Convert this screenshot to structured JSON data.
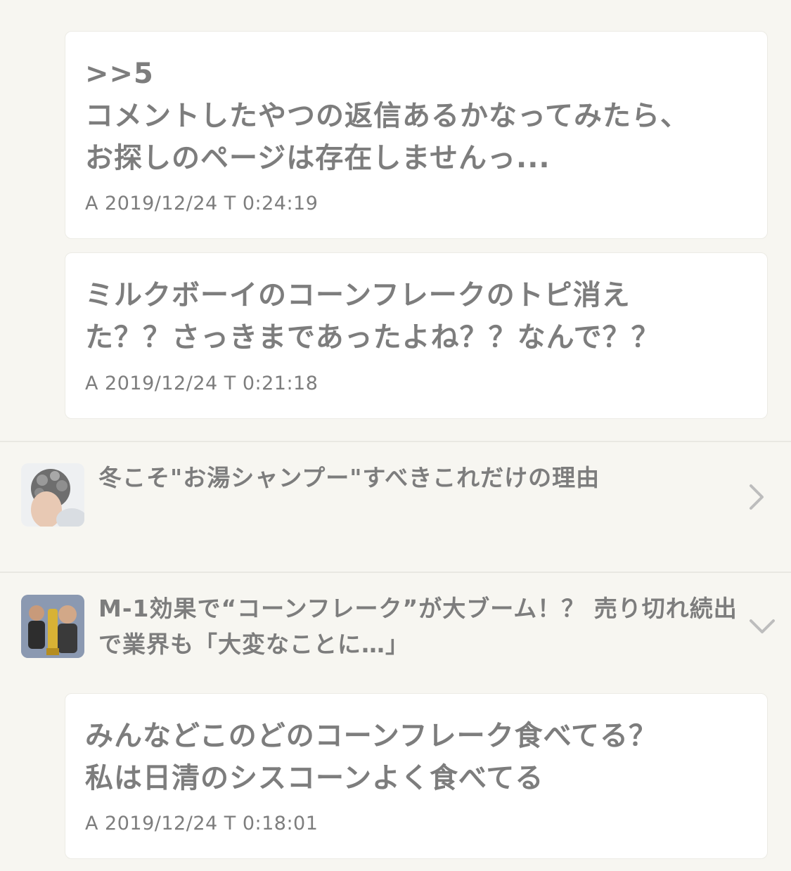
{
  "comments": [
    {
      "body": ">>5\nコメントしたやつの返信あるかなってみたら、\nお探しのページは存在しませんっ...",
      "meta": "A 2019/12/24 T 0:24:19"
    },
    {
      "body": "ミルクボーイのコーンフレークのトピ消え\nた？？さっきまであったよね？？なんで？？",
      "meta": "A 2019/12/24 T 0:21:18"
    },
    {
      "body": "みんなどこのどのコーンフレーク食べてる？\n私は日清のシスコーンよく食べてる",
      "meta": "A 2019/12/24 T 0:18:01"
    }
  ],
  "related": [
    {
      "title": "冬こそ\"お湯シャンプー\"すべきこれだけの理由",
      "icon": "chevron-right-icon"
    },
    {
      "title": "M-1効果で“コーンフレーク”が大ブーム！？ 売り切れ続出で業界も「大変なことに…」",
      "icon": "chevron-down-icon"
    }
  ],
  "colors": {
    "background": "#f7f6f1",
    "card": "#ffffff",
    "text": "#7d7d7d",
    "chevron": "#bdbdbd"
  }
}
